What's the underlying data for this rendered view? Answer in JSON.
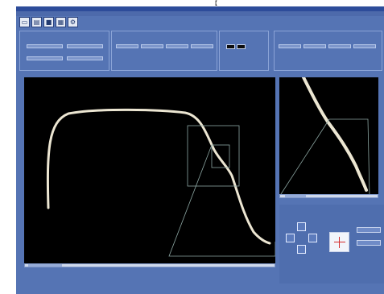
{
  "window": {
    "title": "",
    "menu": ""
  },
  "toolbar": {
    "buttons": [
      {
        "name": "file-icon"
      },
      {
        "name": "open-icon"
      },
      {
        "name": "save-icon"
      },
      {
        "name": "print-icon"
      },
      {
        "name": "settings-icon"
      }
    ]
  },
  "hint": "",
  "groups": {
    "left_group": {
      "label": "",
      "sub1": "",
      "sub2": "",
      "fields": [
        "",
        "",
        "",
        ""
      ]
    },
    "mid_group": {
      "label": "",
      "fields": [
        "",
        "",
        "",
        ""
      ]
    },
    "switch_group": {
      "label": "",
      "sub": ""
    },
    "right_group": {
      "label": "",
      "fields": [
        "",
        "",
        "",
        ""
      ]
    }
  },
  "main_plot": {
    "label": ""
  },
  "side_plot": {},
  "control_panel": {
    "label": "",
    "buttons": [
      "",
      ""
    ]
  },
  "status": {
    "left": "",
    "right": ""
  },
  "watermark": "【"
}
